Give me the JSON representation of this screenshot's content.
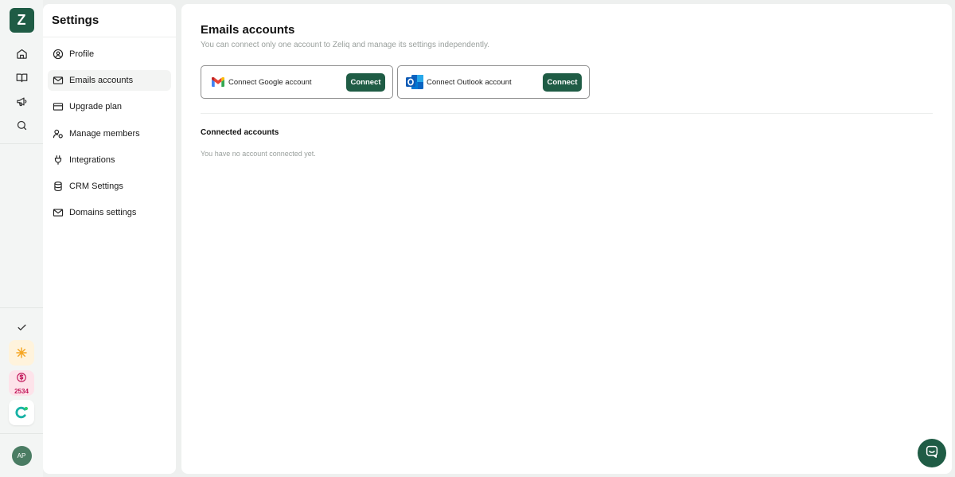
{
  "app": {
    "logo_text": "Z",
    "brand_color": "#1f5c45",
    "rail_icons": [
      "home-icon",
      "book-icon",
      "megaphone-icon",
      "search-icon"
    ],
    "rail_bottom": {
      "tasks_icon": "check-icon",
      "spark_icon": "sparkle-icon",
      "credits_icon": "dollar-coin-icon",
      "credits_count": "2534",
      "extension_icon": "c-logo-icon",
      "avatar_initials": "AP"
    }
  },
  "settings": {
    "title": "Settings",
    "items": [
      {
        "label": "Profile",
        "icon": "user-circle-icon"
      },
      {
        "label": "Emails accounts",
        "icon": "mail-icon",
        "active": true
      },
      {
        "label": "Upgrade plan",
        "icon": "credit-card-icon"
      },
      {
        "label": "Manage members",
        "icon": "members-gear-icon"
      },
      {
        "label": "Integrations",
        "icon": "plug-icon"
      },
      {
        "label": "CRM Settings",
        "icon": "database-icon"
      },
      {
        "label": "Domains settings",
        "icon": "mail-icon"
      }
    ]
  },
  "main": {
    "title": "Emails accounts",
    "subtitle": "You can connect only one account to Zeliq and manage its settings independently.",
    "providers": [
      {
        "label": "Connect Google account",
        "button": "Connect",
        "icon": "gmail-icon"
      },
      {
        "label": "Connect Outlook account",
        "button": "Connect",
        "icon": "outlook-icon"
      }
    ],
    "connected_title": "Connected accounts",
    "connected_empty": "You have no account connected yet."
  },
  "chat": {
    "icon": "chat-icon"
  }
}
